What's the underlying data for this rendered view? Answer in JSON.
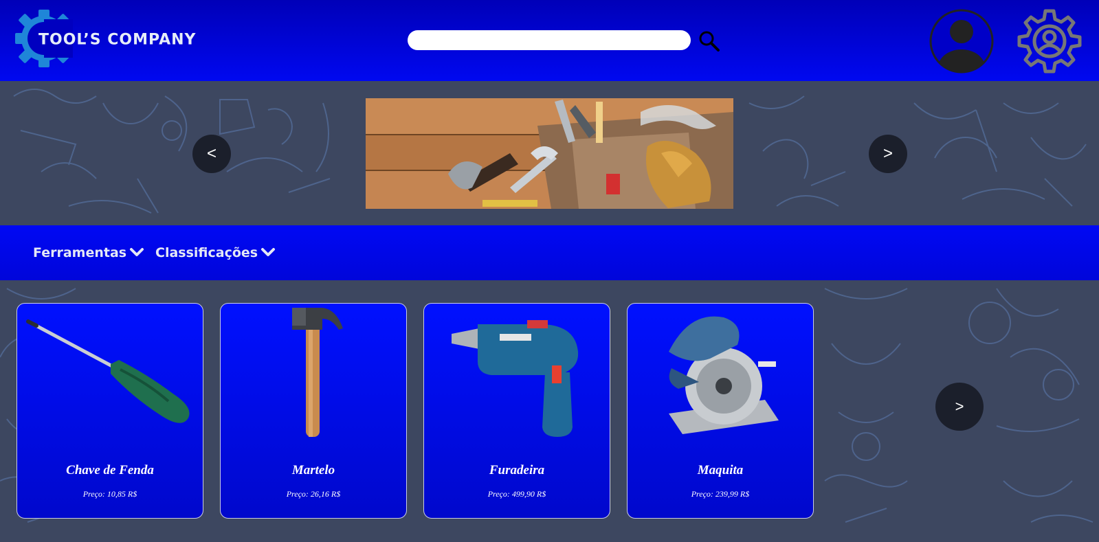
{
  "header": {
    "logo_text": "TOOL’S COMPANY",
    "search": {
      "placeholder": "",
      "value": ""
    }
  },
  "hero": {
    "prev_label": "<",
    "next_label": ">"
  },
  "nav": {
    "items": [
      {
        "label": "Ferramentas"
      },
      {
        "label": "Classificações"
      }
    ]
  },
  "products": {
    "items": [
      {
        "name": "Chave de Fenda",
        "price": "Preço: 10,85 R$",
        "icon": "screwdriver"
      },
      {
        "name": "Martelo",
        "price": "Preço: 26,16 R$",
        "icon": "hammer"
      },
      {
        "name": "Furadeira",
        "price": "Preço: 499,90 R$",
        "icon": "drill"
      },
      {
        "name": "Maquita",
        "price": "Preço: 239,99 R$",
        "icon": "circular-saw"
      }
    ],
    "next_label": ">"
  },
  "colors": {
    "header_blue": "#0000b8",
    "nav_blue": "#0008f4",
    "card_blue": "#0010ff",
    "page_bg": "#3d4760",
    "carousel_button": "#1b1f2b"
  }
}
